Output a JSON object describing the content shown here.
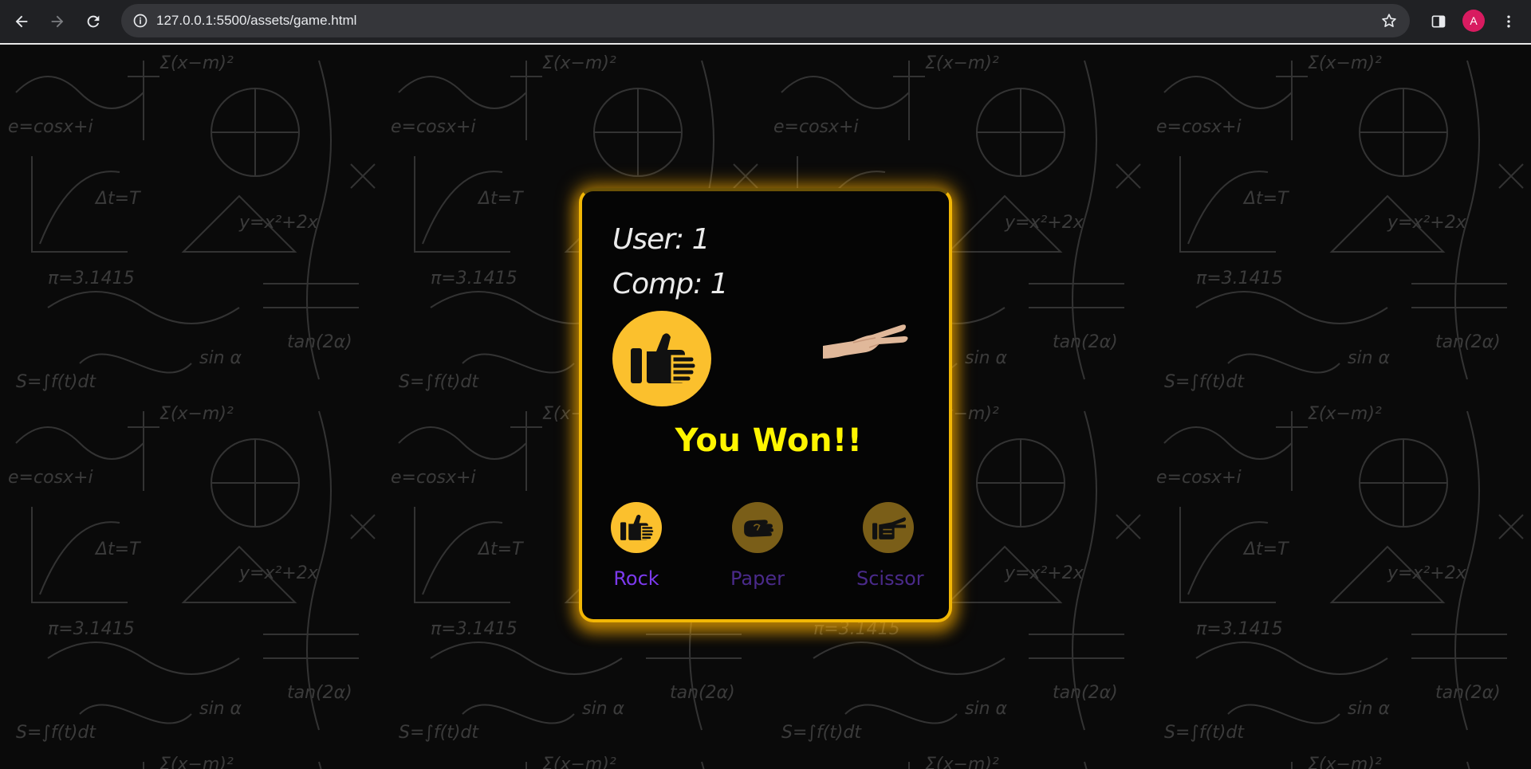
{
  "browser": {
    "url": "127.0.0.1:5500/assets/game.html",
    "profile_initial": "A",
    "back_icon": "arrow-left-icon",
    "forward_icon": "arrow-right-icon",
    "reload_icon": "reload-icon",
    "site_info_icon": "info-icon",
    "bookmark_icon": "star-icon",
    "side_panel_icon": "side-panel-icon",
    "menu_icon": "kebab-menu-icon",
    "profile_color": "#d81b60"
  },
  "game": {
    "user_score": "User: 1",
    "comp_score": "Comp: 1",
    "user_choice_icon": "fist-rock-icon",
    "computer_choice": "hand-scissor-image",
    "result_text": "You Won!!",
    "choices": [
      {
        "label": "Rock",
        "icon": "fist-rock-icon",
        "selected": true
      },
      {
        "label": "Paper",
        "icon": "hand-paper-icon",
        "selected": false
      },
      {
        "label": "Scissor",
        "icon": "hand-scissor-icon",
        "selected": false
      }
    ]
  },
  "colors": {
    "accent": "#fbc02d",
    "card_border": "#f2b705",
    "result": "#fff500",
    "choice_label": "#7c3aed",
    "background": "#0a0a0a"
  }
}
